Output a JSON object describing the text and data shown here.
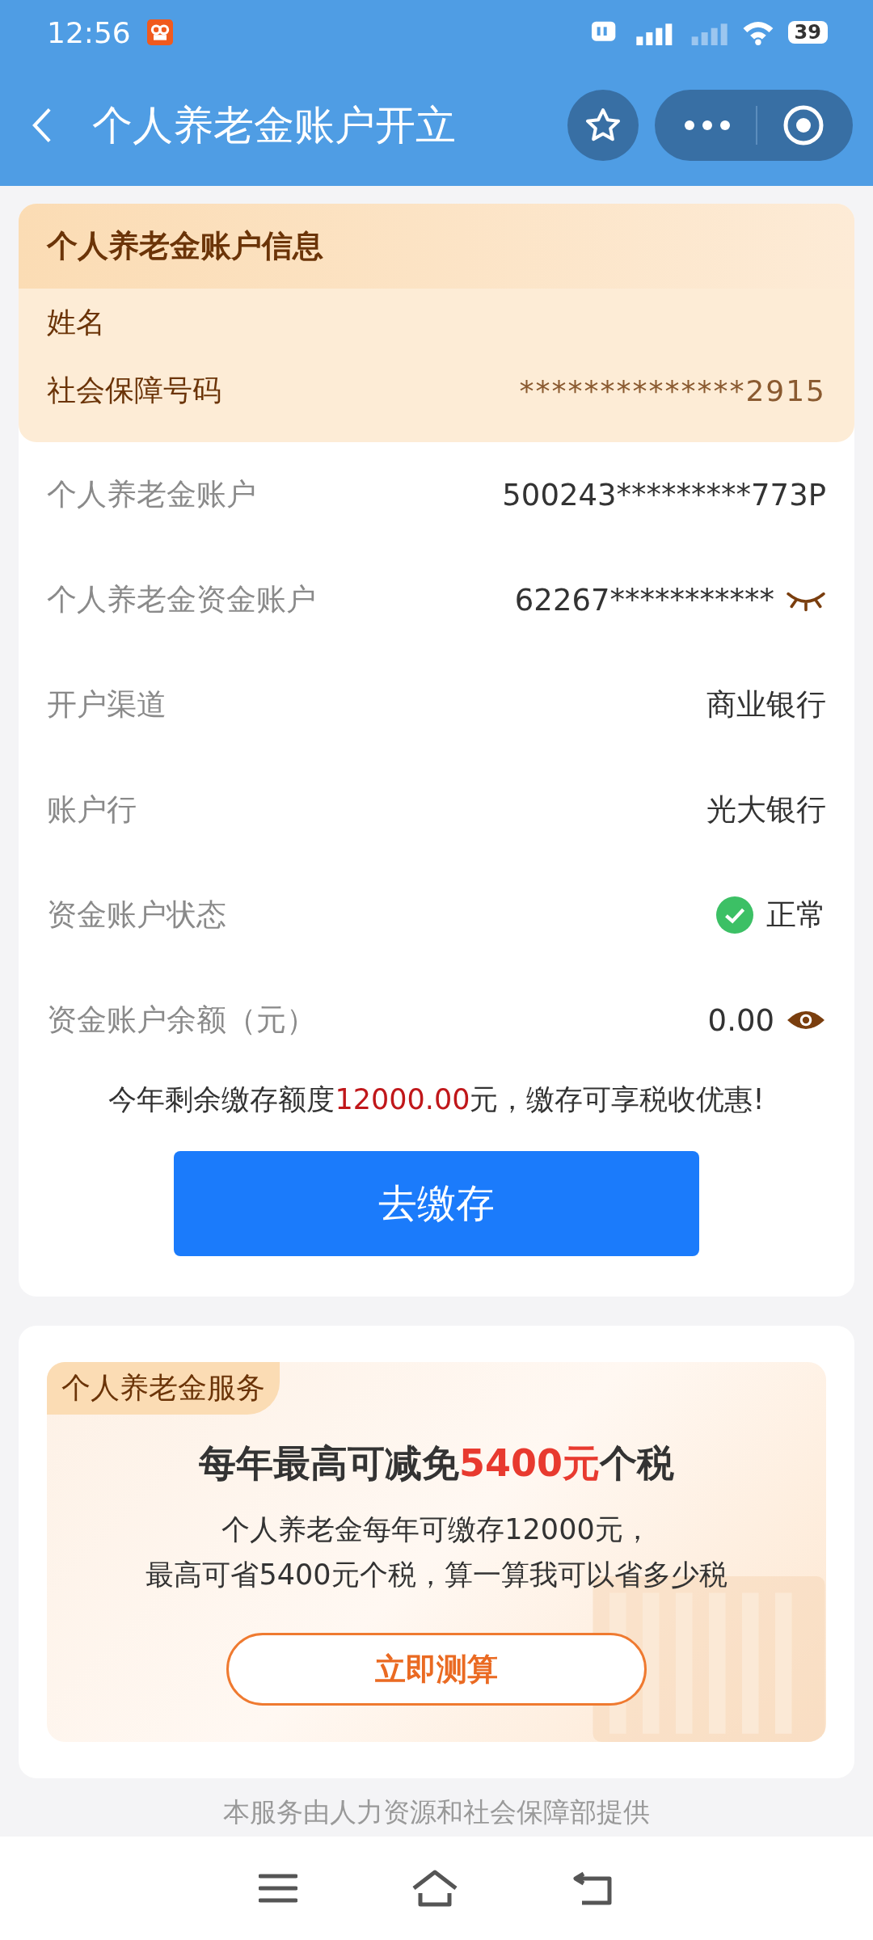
{
  "status_bar": {
    "time": "12:56",
    "battery": "39"
  },
  "header": {
    "title": "个人养老金账户开立"
  },
  "account_card": {
    "title": "个人养老金账户信息",
    "info_rows": [
      {
        "label": "姓名"
      },
      {
        "label": "社会保障号码",
        "value": "**************2915"
      }
    ],
    "rows": [
      {
        "kind": "plain",
        "label": "个人养老金账户",
        "value": "500243*********773P"
      },
      {
        "kind": "masked",
        "label": "个人养老金资金账户",
        "value": "62267***********",
        "visible": false
      },
      {
        "kind": "plain",
        "label": "开户渠道",
        "value": "商业银行"
      },
      {
        "kind": "plain",
        "label": "账户行",
        "value": "光大银行"
      },
      {
        "kind": "status",
        "label": "资金账户状态",
        "value": "正常"
      },
      {
        "kind": "masked",
        "label": "资金账户余额（元）",
        "value": "0.00",
        "visible": true
      }
    ],
    "quota_note": {
      "prefix": "今年剩余缴存额度",
      "amount": "12000.00",
      "suffix": "元，缴存可享税收优惠!"
    },
    "deposit_button": "去缴存"
  },
  "service_card": {
    "tag": "个人养老金服务",
    "headline": {
      "prefix": "每年最高可减免",
      "amount": "5400元",
      "suffix": "个税"
    },
    "lines": [
      "个人养老金每年可缴存12000元，",
      "最高可省5400元个税，算一算我可以省多少税"
    ],
    "button": "立即测算"
  },
  "footer": "本服务由人力资源和社会保障部提供"
}
